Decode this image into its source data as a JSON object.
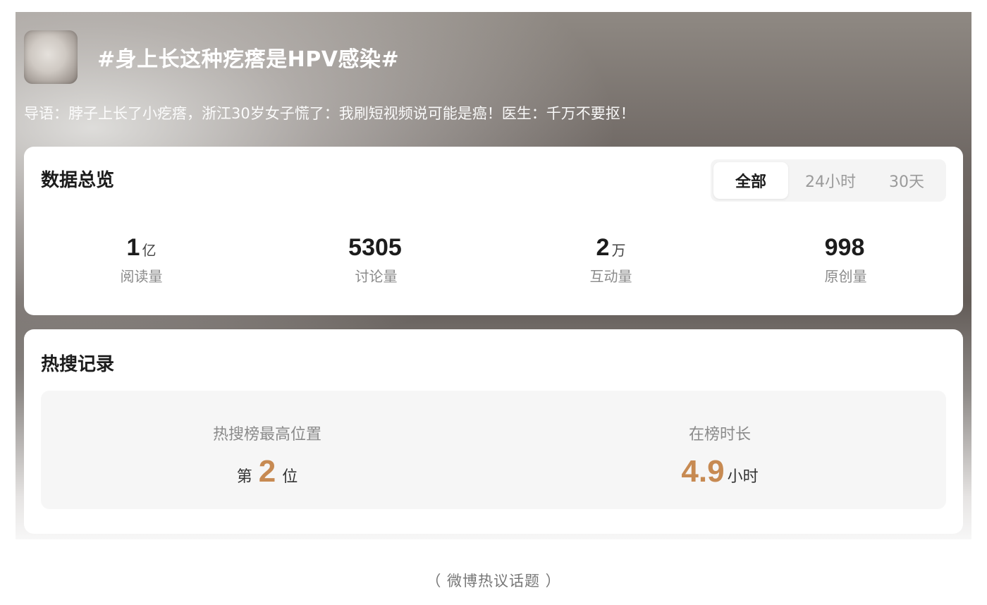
{
  "topic": {
    "title": "#身上长这种疙瘩是HPV感染#",
    "lead": "导语：脖子上长了小疙瘩，浙江30岁女子慌了：我刷短视频说可能是癌！医生：千万不要抠！"
  },
  "overview": {
    "title": "数据总览",
    "tabs": [
      {
        "label": "全部",
        "active": true
      },
      {
        "label": "24小时",
        "active": false
      },
      {
        "label": "30天",
        "active": false
      }
    ],
    "stats": [
      {
        "value": "1",
        "unit": "亿",
        "label": "阅读量"
      },
      {
        "value": "5305",
        "unit": "",
        "label": "讨论量"
      },
      {
        "value": "2",
        "unit": "万",
        "label": "互动量"
      },
      {
        "value": "998",
        "unit": "",
        "label": "原创量"
      }
    ]
  },
  "hot_search": {
    "title": "热搜记录",
    "highest_position": {
      "label": "热搜榜最高位置",
      "prefix": "第",
      "value": "2",
      "suffix": "位"
    },
    "duration": {
      "label": "在榜时长",
      "value": "4.9",
      "suffix": "小时"
    }
  },
  "caption": "（ 微博热议话题 ）",
  "colors": {
    "accent": "#c78a52",
    "card_bg": "#ffffff",
    "panel_bg": "#f6f6f6"
  }
}
